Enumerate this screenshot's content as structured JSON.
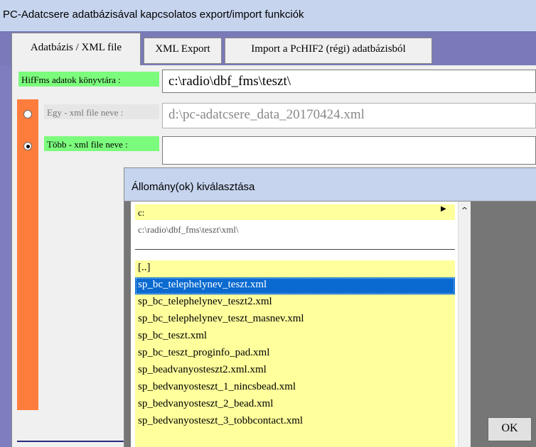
{
  "window": {
    "title": "PC-Adatcsere adatbázisával kapcsolatos export/import funkciók"
  },
  "tabs": [
    {
      "label": "Adatbázis / XML file",
      "active": true
    },
    {
      "label": "XML Export",
      "active": false
    },
    {
      "label": "Import a PcHIF2 (régi) adatbázisból",
      "active": false
    }
  ],
  "db_folder": {
    "label": "HifFms adatok könyvtára :",
    "value": "c:\\radio\\dbf_fms\\teszt\\"
  },
  "single_xml": {
    "label": "Egy -  xml file neve :",
    "value": "d:\\pc-adatcsere_data_20170424.xml",
    "selected": false
  },
  "multi_xml": {
    "label": "Több -  xml file neve :",
    "value": "",
    "selected": true
  },
  "file_dialog": {
    "title": "Állomány(ok) kiválasztása",
    "drive": "c:",
    "path": "c:\\radio\\dbf_fms\\teszt\\xml\\",
    "files": [
      "[..]",
      "sp_bc_telephelynev_teszt.xml",
      "sp_bc_telephelynev_teszt2.xml",
      "sp_bc_telephelynev_teszt_masnev.xml",
      "sp_bc_teszt.xml",
      "sp_bc_teszt_proginfo_pad.xml",
      "sp_beadvanyosteszt2.xml.xml",
      "sp_bedvanyosteszt_1_nincsbead.xml",
      "sp_bedvanyosteszt_2_bead.xml",
      "sp_bedvanyosteszt_3_tobbcontact.xml"
    ],
    "selected_index": 1,
    "ok_label": "OK"
  },
  "icons": {
    "drive_arrow": "triangle-right-icon",
    "scroll_up": "chevron-up-icon"
  },
  "colors": {
    "label_green": "#7cfc7c",
    "list_yellow": "#ffff9c",
    "selection_blue": "#0a6ad0",
    "side_orange": "#ff7d3c"
  }
}
